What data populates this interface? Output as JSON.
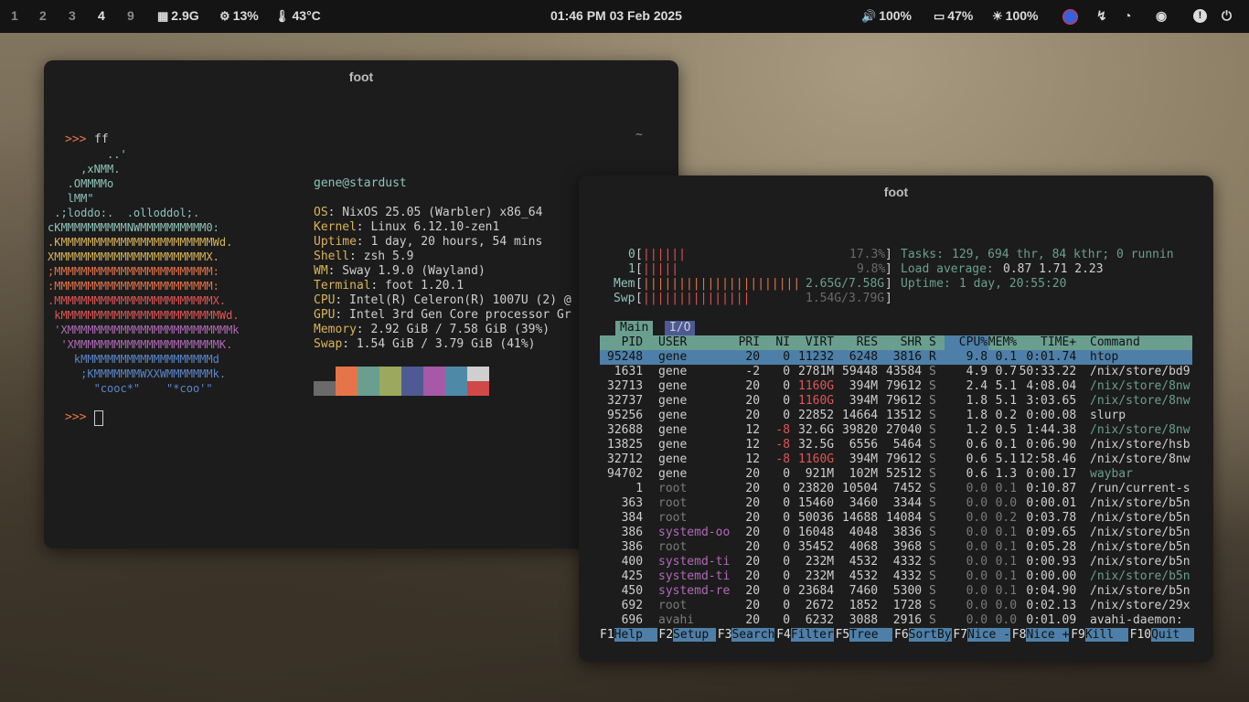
{
  "topbar": {
    "workspaces": [
      "1",
      "2",
      "3",
      "4",
      "9"
    ],
    "active_workspace": "4",
    "memory": "2.9G",
    "cpu": "13%",
    "temp": "43°C",
    "clock": "01:46 PM 03 Feb 2025",
    "volume": "100%",
    "battery": "47%",
    "brightness": "100%"
  },
  "win1": {
    "title": "foot",
    "prompt": ">>>",
    "cmd": "ff",
    "tilde": "~",
    "logo": [
      {
        "text": "         ..'",
        "color": "#8fc4b8"
      },
      {
        "text": "     ,xNMM.",
        "color": "#8fc4b8"
      },
      {
        "text": "   .OMMMMo",
        "color": "#8fc4b8"
      },
      {
        "text": "   lMM\"",
        "color": "#8fc4b8"
      },
      {
        "text": " .;loddo:.  .olloddol;.",
        "color": "#8fc4b8"
      },
      {
        "text": "cKMMMMMMMMMMNWMMMMMMMMMM0:",
        "color": "#8fc4b8"
      },
      {
        "text": ".KMMMMMMMMMMMMMMMMMMMMMMMWd.",
        "color": "#d9b45a"
      },
      {
        "text": "XMMMMMMMMMMMMMMMMMMMMMMMX.",
        "color": "#d9b45a"
      },
      {
        "text": ";MMMMMMMMMMMMMMMMMMMMMMMM:",
        "color": "#e6744a"
      },
      {
        "text": ":MMMMMMMMMMMMMMMMMMMMMMMM:",
        "color": "#e6744a"
      },
      {
        "text": ".MMMMMMMMMMMMMMMMMMMMMMMMX.",
        "color": "#e05555"
      },
      {
        "text": " kMMMMMMMMMMMMMMMMMMMMMMMMWd.",
        "color": "#e05555"
      },
      {
        "text": " 'XMMMMMMMMMMMMMMMMMMMMMMMMMk",
        "color": "#b06ab8"
      },
      {
        "text": "  'XMMMMMMMMMMMMMMMMMMMMMMK.",
        "color": "#b06ab8"
      },
      {
        "text": "    kMMMMMMMMMMMMMMMMMMMMd",
        "color": "#5a86c8"
      },
      {
        "text": "     ;KMMMMMMMWXXWMMMMMMMk.",
        "color": "#5a86c8"
      },
      {
        "text": "       \"cooc*\"    \"*coo'\"",
        "color": "#5a86c8"
      }
    ],
    "userhost": "gene@stardust",
    "info": [
      {
        "k": "OS",
        "v": "NixOS 25.05 (Warbler) x86_64"
      },
      {
        "k": "Kernel",
        "v": "Linux 6.12.10-zen1"
      },
      {
        "k": "Uptime",
        "v": "1 day, 20 hours, 54 mins"
      },
      {
        "k": "Shell",
        "v": "zsh 5.9"
      },
      {
        "k": "WM",
        "v": "Sway 1.9.0 (Wayland)"
      },
      {
        "k": "Terminal",
        "v": "foot 1.20.1"
      },
      {
        "k": "CPU",
        "v": "Intel(R) Celeron(R) 1007U (2) @"
      },
      {
        "k": "GPU",
        "v": "Intel 3rd Gen Core processor Gr"
      },
      {
        "k": "Memory",
        "v": "2.92 GiB / 7.58 GiB (39%)"
      },
      {
        "k": "Swap",
        "v": "1.54 GiB / 3.79 GiB (41%)"
      }
    ],
    "palette_top": [
      "#1c1c1c",
      "#e6744a",
      "#6a9f8f",
      "#9ca85e",
      "#4d5a94",
      "#a659a8",
      "#4e8aa8",
      "#cfcfcf"
    ],
    "palette_bottom": [
      "#6a6a6a",
      "#e6744a",
      "#6a9f8f",
      "#9ca85e",
      "#4d5a94",
      "#a659a8",
      "#4e8aa8",
      "#d04848"
    ]
  },
  "win2": {
    "title": "foot",
    "cpu0": {
      "label": "0",
      "bar": "||||||",
      "value": "17.3%"
    },
    "cpu1": {
      "label": "1",
      "bar": "|||||",
      "value": "9.8%"
    },
    "mem": {
      "label": "Mem",
      "bar": "||||||||||||||||||||||",
      "value": "2.65G/7.58G"
    },
    "swp": {
      "label": "Swp",
      "bar": "|||||||||||||||",
      "value": "1.54G/3.79G"
    },
    "tasks_label": "Tasks:",
    "tasks_value": "129, 694 thr, 84 kthr; 0 runnin",
    "load_label": "Load average:",
    "load_value": "0.87 1.71 2.23",
    "uptime_label": "Uptime:",
    "uptime_value": "1 day, 20:55:20",
    "tabs": [
      "Main",
      "I/O"
    ],
    "columns": [
      "PID",
      "USER",
      "PRI",
      "NI",
      "VIRT",
      "RES",
      "SHR",
      "S",
      "CPU%",
      "MEM%",
      "TIME+",
      "Command"
    ],
    "rows": [
      {
        "pid": "95248",
        "user": "gene",
        "pri": "20",
        "ni": "0",
        "virt": "11232",
        "res": "6248",
        "shr": "3816",
        "s": "R",
        "cpu": "9.8",
        "mem": "0.1",
        "time": "0:01.74",
        "cmd": "htop",
        "hl": true
      },
      {
        "pid": "1631",
        "user": "gene",
        "pri": "-2",
        "ni": "0",
        "virt": "2781M",
        "res": "59448",
        "shr": "43584",
        "s": "S",
        "cpu": "4.9",
        "mem": "0.7",
        "time": "50:33.22",
        "cmd": "/nix/store/bd9"
      },
      {
        "pid": "32713",
        "user": "gene",
        "pri": "20",
        "ni": "0",
        "virt": "1160G",
        "res": "394M",
        "shr": "79612",
        "s": "S",
        "cpu": "2.4",
        "mem": "5.1",
        "time": "4:08.04",
        "cmd": "/nix/store/8nw",
        "cmdc": "teal",
        "virtc": "red"
      },
      {
        "pid": "32737",
        "user": "gene",
        "pri": "20",
        "ni": "0",
        "virt": "1160G",
        "res": "394M",
        "shr": "79612",
        "s": "S",
        "cpu": "1.8",
        "mem": "5.1",
        "time": "3:03.65",
        "cmd": "/nix/store/8nw",
        "cmdc": "teal",
        "virtc": "red"
      },
      {
        "pid": "95256",
        "user": "gene",
        "pri": "20",
        "ni": "0",
        "virt": "22852",
        "res": "14664",
        "shr": "13512",
        "s": "S",
        "cpu": "1.8",
        "mem": "0.2",
        "time": "0:00.08",
        "cmd": "slurp"
      },
      {
        "pid": "32688",
        "user": "gene",
        "pri": "12",
        "ni": "-8",
        "virt": "32.6G",
        "res": "39820",
        "shr": "27040",
        "s": "S",
        "cpu": "1.2",
        "mem": "0.5",
        "time": "1:44.38",
        "cmd": "/nix/store/8nw",
        "cmdc": "teal",
        "nic": "red"
      },
      {
        "pid": "13825",
        "user": "gene",
        "pri": "12",
        "ni": "-8",
        "virt": "32.5G",
        "res": "6556",
        "shr": "5464",
        "s": "S",
        "cpu": "0.6",
        "mem": "0.1",
        "time": "0:06.90",
        "cmd": "/nix/store/hsb",
        "nic": "red"
      },
      {
        "pid": "32712",
        "user": "gene",
        "pri": "12",
        "ni": "-8",
        "virt": "1160G",
        "res": "394M",
        "shr": "79612",
        "s": "S",
        "cpu": "0.6",
        "mem": "5.1",
        "time": "12:58.46",
        "cmd": "/nix/store/8nw",
        "nic": "red",
        "virtc": "red"
      },
      {
        "pid": "94702",
        "user": "gene",
        "pri": "20",
        "ni": "0",
        "virt": "921M",
        "res": "102M",
        "shr": "52512",
        "s": "S",
        "cpu": "0.6",
        "mem": "1.3",
        "time": "0:00.17",
        "cmd": "waybar",
        "cmdc": "teal"
      },
      {
        "pid": "1",
        "user": "root",
        "pri": "20",
        "ni": "0",
        "virt": "23820",
        "res": "10504",
        "shr": "7452",
        "s": "S",
        "cpu": "0.0",
        "mem": "0.1",
        "time": "0:10.87",
        "cmd": "/run/current-s",
        "dim": true
      },
      {
        "pid": "363",
        "user": "root",
        "pri": "20",
        "ni": "0",
        "virt": "15460",
        "res": "3460",
        "shr": "3344",
        "s": "S",
        "cpu": "0.0",
        "mem": "0.0",
        "time": "0:00.01",
        "cmd": "/nix/store/b5n",
        "dim": true
      },
      {
        "pid": "384",
        "user": "root",
        "pri": "20",
        "ni": "0",
        "virt": "50036",
        "res": "14688",
        "shr": "14084",
        "s": "S",
        "cpu": "0.0",
        "mem": "0.2",
        "time": "0:03.78",
        "cmd": "/nix/store/b5n",
        "dim": true
      },
      {
        "pid": "386",
        "user": "systemd-oo",
        "pri": "20",
        "ni": "0",
        "virt": "16048",
        "res": "4048",
        "shr": "3836",
        "s": "S",
        "cpu": "0.0",
        "mem": "0.1",
        "time": "0:09.65",
        "cmd": "/nix/store/b5n",
        "purple": true
      },
      {
        "pid": "386",
        "user": "root",
        "pri": "20",
        "ni": "0",
        "virt": "35452",
        "res": "4068",
        "shr": "3968",
        "s": "S",
        "cpu": "0.0",
        "mem": "0.1",
        "time": "0:05.28",
        "cmd": "/nix/store/b5n",
        "dim": true
      },
      {
        "pid": "400",
        "user": "systemd-ti",
        "pri": "20",
        "ni": "0",
        "virt": "232M",
        "res": "4532",
        "shr": "4332",
        "s": "S",
        "cpu": "0.0",
        "mem": "0.1",
        "time": "0:00.93",
        "cmd": "/nix/store/b5n",
        "purple": true
      },
      {
        "pid": "425",
        "user": "systemd-ti",
        "pri": "20",
        "ni": "0",
        "virt": "232M",
        "res": "4532",
        "shr": "4332",
        "s": "S",
        "cpu": "0.0",
        "mem": "0.1",
        "time": "0:00.00",
        "cmd": "/nix/store/b5n",
        "purple": true,
        "cmdc": "teal"
      },
      {
        "pid": "450",
        "user": "systemd-re",
        "pri": "20",
        "ni": "0",
        "virt": "23684",
        "res": "7460",
        "shr": "5300",
        "s": "S",
        "cpu": "0.0",
        "mem": "0.1",
        "time": "0:04.90",
        "cmd": "/nix/store/b5n",
        "purple": true
      },
      {
        "pid": "692",
        "user": "root",
        "pri": "20",
        "ni": "0",
        "virt": "2672",
        "res": "1852",
        "shr": "1728",
        "s": "S",
        "cpu": "0.0",
        "mem": "0.0",
        "time": "0:02.13",
        "cmd": "/nix/store/29x",
        "dim": true
      },
      {
        "pid": "696",
        "user": "avahi",
        "pri": "20",
        "ni": "0",
        "virt": "6232",
        "res": "3088",
        "shr": "2916",
        "s": "S",
        "cpu": "0.0",
        "mem": "0.0",
        "time": "0:01.09",
        "cmd": "avahi-daemon:",
        "dim": true
      }
    ],
    "fkeys": [
      {
        "k": "F1",
        "l": "Help  "
      },
      {
        "k": "F2",
        "l": "Setup "
      },
      {
        "k": "F3",
        "l": "Search"
      },
      {
        "k": "F4",
        "l": "Filter"
      },
      {
        "k": "F5",
        "l": "Tree  "
      },
      {
        "k": "F6",
        "l": "SortBy"
      },
      {
        "k": "F7",
        "l": "Nice -"
      },
      {
        "k": "F8",
        "l": "Nice +"
      },
      {
        "k": "F9",
        "l": "Kill  "
      },
      {
        "k": "F10",
        "l": "Quit  "
      }
    ]
  }
}
